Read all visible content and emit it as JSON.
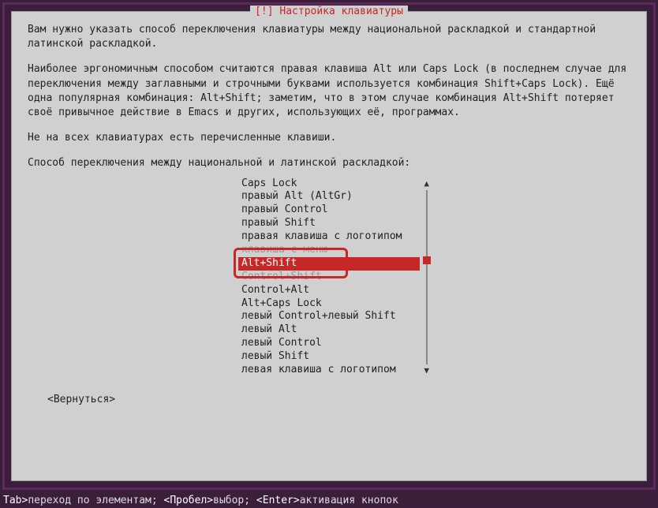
{
  "dialog": {
    "title": "[!] Настройка клавиатуры",
    "paragraph1": "Вам нужно указать способ переключения клавиатуры между национальной раскладкой и стандартной латинской раскладкой.",
    "paragraph2": "Наиболее эргономичным способом считаются правая клавиша Alt или Caps Lock (в последнем случае для переключения между заглавными и строчными буквами используется комбинация Shift+Caps Lock). Ещё одна популярная комбинация: Alt+Shift; заметим, что в этом случае комбинация Alt+Shift потеряет своё привычное действие в Emacs и других, использующих её, программах.",
    "paragraph3": "Не на всех клавиатурах есть перечисленные клавиши.",
    "list_label": "Способ переключения между национальной и латинской раскладкой:",
    "back_label": "<Вернуться>"
  },
  "options": [
    {
      "label": "Caps Lock",
      "selected": false,
      "ghost": false
    },
    {
      "label": "правый Alt (AltGr)",
      "selected": false,
      "ghost": false
    },
    {
      "label": "правый Control",
      "selected": false,
      "ghost": false
    },
    {
      "label": "правый Shift",
      "selected": false,
      "ghost": false
    },
    {
      "label": "правая клавиша с логотипом",
      "selected": false,
      "ghost": false
    },
    {
      "label": "клавиша с меню",
      "selected": false,
      "ghost": true
    },
    {
      "label": "Alt+Shift",
      "selected": true,
      "ghost": false
    },
    {
      "label": "Control+Shift",
      "selected": false,
      "ghost": true
    },
    {
      "label": "Control+Alt",
      "selected": false,
      "ghost": false
    },
    {
      "label": "Alt+Caps Lock",
      "selected": false,
      "ghost": false
    },
    {
      "label": "левый Control+левый Shift",
      "selected": false,
      "ghost": false
    },
    {
      "label": "левый Alt",
      "selected": false,
      "ghost": false
    },
    {
      "label": "левый Control",
      "selected": false,
      "ghost": false
    },
    {
      "label": "левый Shift",
      "selected": false,
      "ghost": false
    },
    {
      "label": "левая клавиша с логотипом",
      "selected": false,
      "ghost": false
    }
  ],
  "statusbar": {
    "tab_key": "Tab>",
    "tab_text": "переход по элементам; ",
    "space_key": "<Пробел>",
    "space_text": "выбор; ",
    "enter_key": "<Enter>",
    "enter_text": "активация кнопок"
  }
}
